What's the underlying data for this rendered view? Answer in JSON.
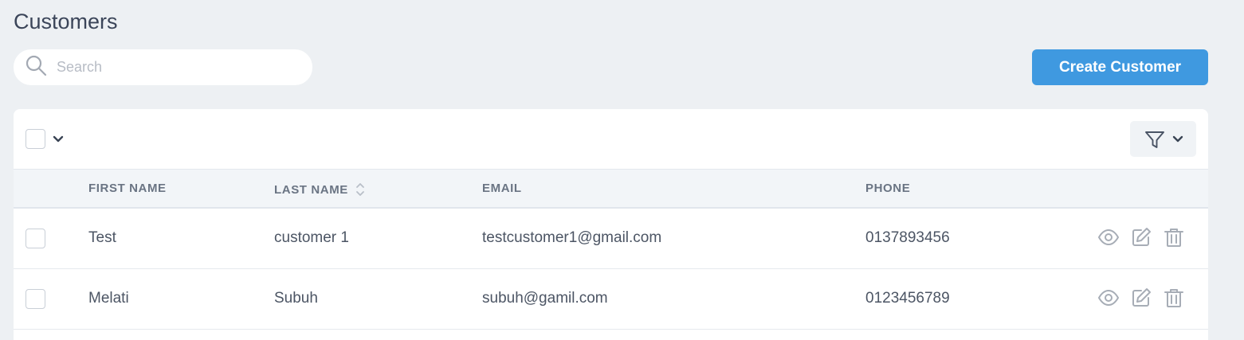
{
  "page": {
    "title": "Customers"
  },
  "search": {
    "placeholder": "Search",
    "icon": "search-icon"
  },
  "create_button": {
    "label": "Create Customer",
    "color": "#3f99e0"
  },
  "table": {
    "columns": {
      "first_name": "FIRST NAME",
      "last_name": "LAST NAME",
      "email": "EMAIL",
      "phone": "PHONE"
    },
    "rows": [
      {
        "first_name": "Test",
        "last_name": "customer 1",
        "email": "testcustomer1@gmail.com",
        "phone": "0137893456"
      },
      {
        "first_name": "Melati",
        "last_name": "Subuh",
        "email": "subuh@gamil.com",
        "phone": "0123456789"
      }
    ],
    "row_actions": [
      "eye-icon",
      "edit-icon",
      "trash-icon"
    ]
  }
}
